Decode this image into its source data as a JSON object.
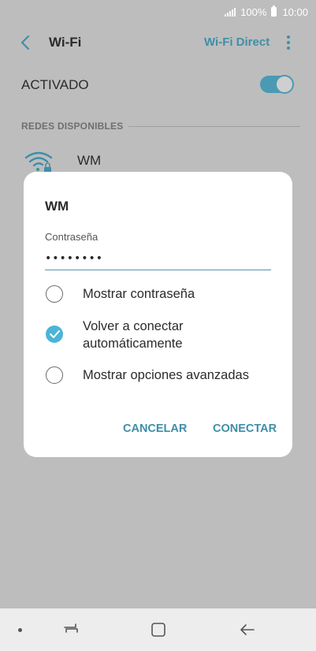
{
  "status_bar": {
    "battery_percent": "100%",
    "time": "10:00"
  },
  "app_bar": {
    "title": "Wi-Fi",
    "wifi_direct_label": "Wi-Fi Direct"
  },
  "wifi_toggle": {
    "label": "ACTIVADO",
    "on": true
  },
  "networks": {
    "header": "REDES DISPONIBLES",
    "items": [
      {
        "name": "WM",
        "icon": "wifi-locked-icon"
      }
    ]
  },
  "dialog": {
    "title": "WM",
    "password_label": "Contraseña",
    "password_value": "••••••••",
    "options": [
      {
        "label": "Mostrar contraseña",
        "checked": false
      },
      {
        "label": "Volver a conectar",
        "label_line2": "automáticamente",
        "checked": true
      },
      {
        "label": "Mostrar opciones avanzadas",
        "checked": false
      }
    ],
    "cancel_label": "CANCELAR",
    "connect_label": "CONECTAR"
  },
  "colors": {
    "accent": "#3e8fa8",
    "check": "#4bb5d6",
    "overlay_background": "#bdbdbd"
  }
}
